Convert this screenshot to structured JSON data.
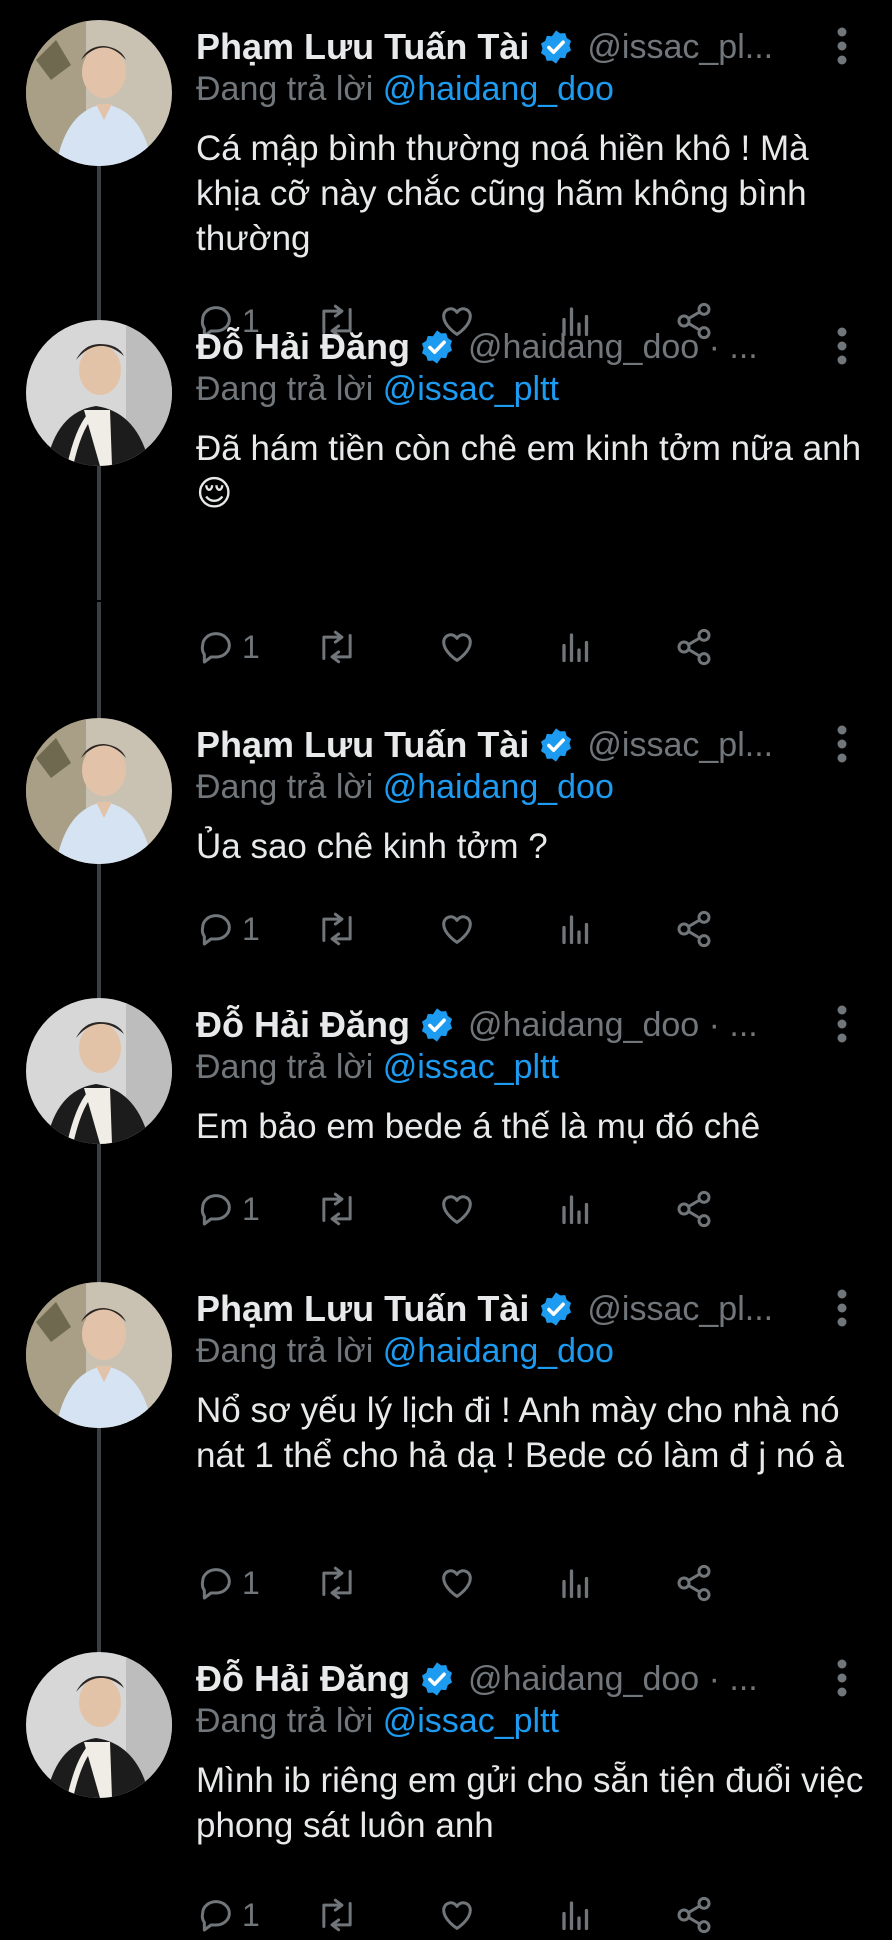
{
  "reply_prefix": "Đang trả lời",
  "tweets": [
    {
      "name": "Phạm Lưu Tuấn Tài",
      "handle": "@issac_pl...",
      "reply_to": "@haidang_doo",
      "text": "Cá mập bình thường noá hiền khô ! Mà khịa cỡ này chắc cũng hãm không bình thường",
      "reply_count": "1"
    },
    {
      "name": "Đỗ Hải Đăng",
      "handle": "@haidang_doo · ...",
      "reply_to": "@issac_pltt",
      "text": "Đã hám tiền còn chê em kinh tởm nữa anh 😌",
      "reply_count": "1"
    },
    {
      "name": "Phạm Lưu Tuấn Tài",
      "handle": "@issac_pl...",
      "reply_to": "@haidang_doo",
      "text": "Ủa sao chê kinh tởm ?",
      "reply_count": "1"
    },
    {
      "name": "Đỗ Hải Đăng",
      "handle": "@haidang_doo · ...",
      "reply_to": "@issac_pltt",
      "text": "Em bảo em bede á thế là mụ đó chê",
      "reply_count": "1"
    },
    {
      "name": "Phạm Lưu Tuấn Tài",
      "handle": "@issac_pl...",
      "reply_to": "@haidang_doo",
      "text": "Nổ sơ yếu lý lịch đi ! Anh mày cho nhà nó nát 1 thể cho hả dạ ! Bede có làm đ j nó à",
      "reply_count": "1"
    },
    {
      "name": "Đỗ Hải Đăng",
      "handle": "@haidang_doo · ...",
      "reply_to": "@issac_pltt",
      "text": "Mình ib riêng em gửi cho sẵn tiện đuổi việc phong sát luôn anh",
      "reply_count": "1"
    }
  ],
  "icons": {
    "reply": "reply-icon",
    "retweet": "retweet-icon",
    "like": "like-icon",
    "views": "views-icon",
    "share": "share-icon",
    "more": "more-icon",
    "verified": "verified-badge-icon"
  },
  "colors": {
    "background": "#000000",
    "text": "#e7e9ea",
    "muted": "#71767b",
    "link": "#1d9bf0",
    "verified": "#1d9bf0",
    "thread_line": "#3a3f44"
  }
}
